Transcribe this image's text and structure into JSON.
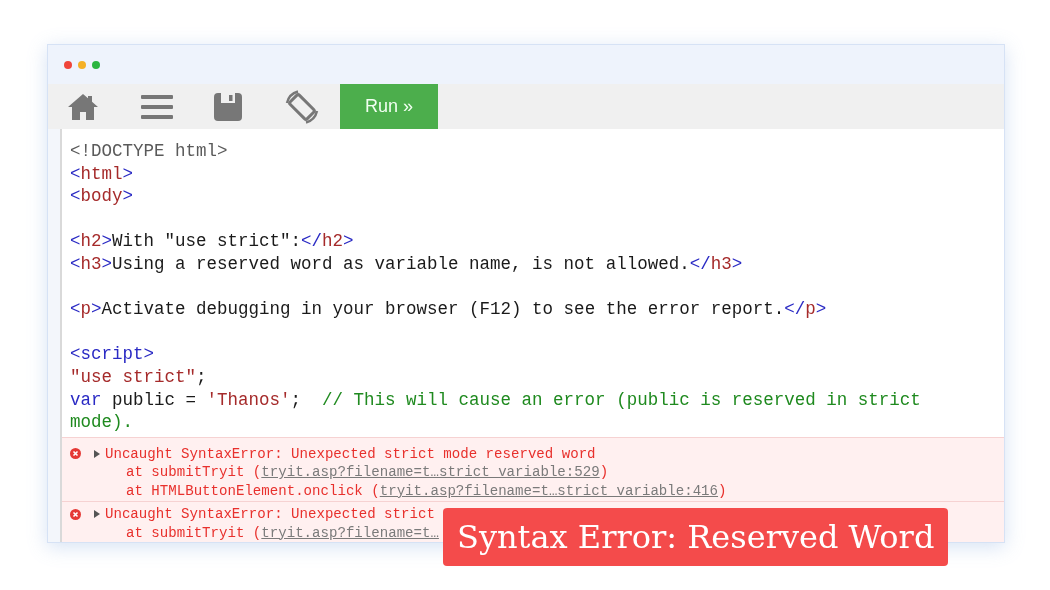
{
  "window": {
    "controls": [
      {
        "color": "#f0443a"
      },
      {
        "color": "#f5b025"
      },
      {
        "color": "#2bb540"
      }
    ]
  },
  "toolbar": {
    "run_button": "Run »"
  },
  "editor": {
    "lines": [
      {
        "kind": "code",
        "tokens": [
          {
            "kind": "doctype",
            "text": "<!DOCTYPE html>"
          }
        ]
      },
      {
        "kind": "code",
        "tokens": [
          {
            "kind": "bracket",
            "text": "<"
          },
          {
            "kind": "tag",
            "text": "html"
          },
          {
            "kind": "bracket",
            "text": ">"
          }
        ]
      },
      {
        "kind": "code",
        "tokens": [
          {
            "kind": "bracket",
            "text": "<"
          },
          {
            "kind": "tag",
            "text": "body"
          },
          {
            "kind": "bracket",
            "text": ">"
          }
        ]
      },
      {
        "kind": "blank"
      },
      {
        "kind": "code",
        "tokens": [
          {
            "kind": "bracket",
            "text": "<"
          },
          {
            "kind": "tag",
            "text": "h2"
          },
          {
            "kind": "bracket",
            "text": ">"
          },
          {
            "kind": "text",
            "text": "With \"use strict\":"
          },
          {
            "kind": "bracket",
            "text": "</"
          },
          {
            "kind": "tag",
            "text": "h2"
          },
          {
            "kind": "bracket",
            "text": ">"
          }
        ]
      },
      {
        "kind": "code",
        "tokens": [
          {
            "kind": "bracket",
            "text": "<"
          },
          {
            "kind": "tag",
            "text": "h3"
          },
          {
            "kind": "bracket",
            "text": ">"
          },
          {
            "kind": "text",
            "text": "Using a reserved word as variable name, is not allowed."
          },
          {
            "kind": "bracket",
            "text": "</"
          },
          {
            "kind": "tag",
            "text": "h3"
          },
          {
            "kind": "bracket",
            "text": ">"
          }
        ]
      },
      {
        "kind": "blank"
      },
      {
        "kind": "code",
        "tokens": [
          {
            "kind": "bracket",
            "text": "<"
          },
          {
            "kind": "tag",
            "text": "p"
          },
          {
            "kind": "bracket",
            "text": ">"
          },
          {
            "kind": "text",
            "text": "Activate debugging in your browser (F12) to see the error report."
          },
          {
            "kind": "bracket",
            "text": "</"
          },
          {
            "kind": "tag",
            "text": "p"
          },
          {
            "kind": "bracket",
            "text": ">"
          }
        ]
      },
      {
        "kind": "blank"
      },
      {
        "kind": "code",
        "tokens": [
          {
            "kind": "script_tag",
            "text": "<script>"
          }
        ]
      },
      {
        "kind": "code",
        "tokens": [
          {
            "kind": "string",
            "text": "\"use strict\""
          },
          {
            "kind": "text",
            "text": ";"
          }
        ]
      },
      {
        "kind": "code",
        "tokens": [
          {
            "kind": "keyword",
            "text": "var"
          },
          {
            "kind": "text",
            "text": " public = "
          },
          {
            "kind": "string",
            "text": "'Thanos'"
          },
          {
            "kind": "text",
            "text": ";  "
          },
          {
            "kind": "comment",
            "text": "// This will cause an error (public is reserved in strict"
          }
        ]
      },
      {
        "kind": "code",
        "tokens": [
          {
            "kind": "comment",
            "text": "mode)."
          }
        ]
      }
    ]
  },
  "console": {
    "errors": [
      {
        "expanded": false,
        "message": "Uncaught SyntaxError: Unexpected strict mode reserved word",
        "frames": [
          {
            "text": "at submitTryit (",
            "link": "tryit.asp?filename=t…strict_variable:529",
            "after": ")"
          },
          {
            "text": "at HTMLButtonElement.onclick (",
            "link": "tryit.asp?filename=t…strict_variable:416",
            "after": ")"
          }
        ]
      },
      {
        "expanded": false,
        "message": "Uncaught SyntaxError: Unexpected strict",
        "frames": [
          {
            "text": "at submitTryit (",
            "link": "tryit.asp?filename=t…"
          }
        ]
      }
    ]
  },
  "caption": "Syntax Error: Reserved Word"
}
